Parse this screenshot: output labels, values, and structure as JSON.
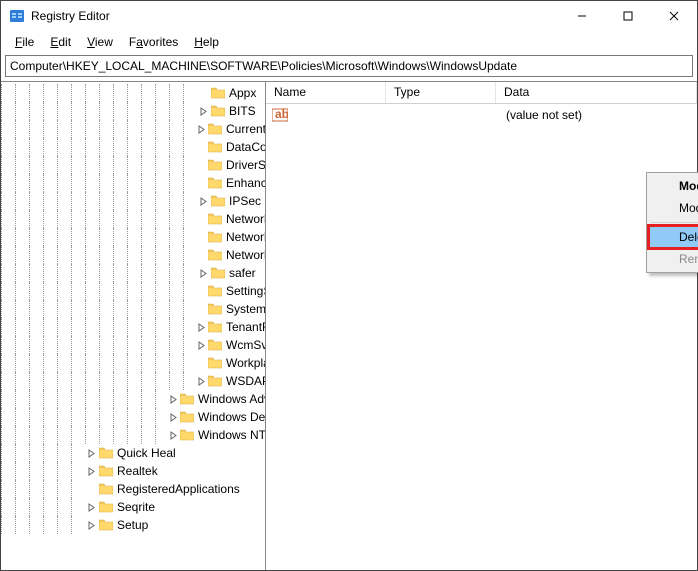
{
  "window": {
    "title": "Registry Editor"
  },
  "menu": {
    "file": "File",
    "edit": "Edit",
    "view": "View",
    "favorites": "Favorites",
    "help": "Help"
  },
  "address": {
    "path": "Computer\\HKEY_LOCAL_MACHINE\\SOFTWARE\\Policies\\Microsoft\\Windows\\WindowsUpdate"
  },
  "tree": {
    "items": [
      {
        "label": "Appx",
        "indent": 14,
        "exp": "none"
      },
      {
        "label": "BITS",
        "indent": 14,
        "exp": "right"
      },
      {
        "label": "CurrentVersion",
        "indent": 14,
        "exp": "right"
      },
      {
        "label": "DataCollection",
        "indent": 14,
        "exp": "none"
      },
      {
        "label": "DriverSearching",
        "indent": 14,
        "exp": "none"
      },
      {
        "label": "EnhancedStorageDevices",
        "indent": 14,
        "exp": "none"
      },
      {
        "label": "IPSec",
        "indent": 14,
        "exp": "right"
      },
      {
        "label": "Network Connections",
        "indent": 14,
        "exp": "none"
      },
      {
        "label": "NetworkConnectivityStatusIndicator",
        "indent": 14,
        "exp": "none"
      },
      {
        "label": "NetworkProvider",
        "indent": 14,
        "exp": "none"
      },
      {
        "label": "safer",
        "indent": 14,
        "exp": "right"
      },
      {
        "label": "SettingSync",
        "indent": 14,
        "exp": "none"
      },
      {
        "label": "System",
        "indent": 14,
        "exp": "none"
      },
      {
        "label": "TenantRestrictions",
        "indent": 14,
        "exp": "right"
      },
      {
        "label": "WcmSvc",
        "indent": 14,
        "exp": "right"
      },
      {
        "label": "WorkplaceJoin",
        "indent": 14,
        "exp": "none"
      },
      {
        "label": "WSDAPI",
        "indent": 14,
        "exp": "right"
      },
      {
        "label": "Windows Advanced Threat Protection",
        "indent": 12,
        "exp": "right"
      },
      {
        "label": "Windows Defender",
        "indent": 12,
        "exp": "right"
      },
      {
        "label": "Windows NT",
        "indent": 12,
        "exp": "right"
      },
      {
        "label": "Quick Heal",
        "indent": 6,
        "exp": "right"
      },
      {
        "label": "Realtek",
        "indent": 6,
        "exp": "right"
      },
      {
        "label": "RegisteredApplications",
        "indent": 6,
        "exp": "none"
      },
      {
        "label": "Seqrite",
        "indent": 6,
        "exp": "right"
      },
      {
        "label": "Setup",
        "indent": 6,
        "exp": "right"
      }
    ]
  },
  "list": {
    "columns": {
      "name": "Name",
      "type": "Type",
      "data": "Data"
    },
    "rows": [
      {
        "icon": "ab",
        "name": "",
        "type": "",
        "data": "(value not set)"
      }
    ]
  },
  "context_menu": {
    "modify": "Modify...",
    "modify_binary": "Modify Binary Data...",
    "delete": "Delete",
    "rename": "Rename"
  }
}
